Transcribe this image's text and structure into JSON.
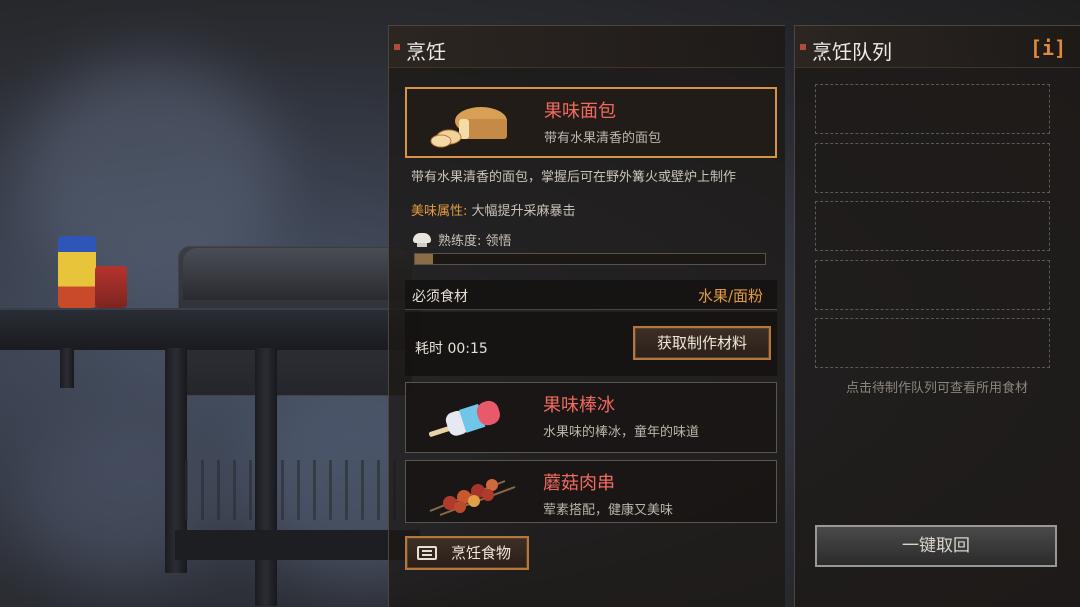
{
  "cooking_panel": {
    "title": "烹饪"
  },
  "queue_panel": {
    "title": "烹饪队列",
    "info_label": "[i]",
    "hint": "点击待制作队列可查看所用食材",
    "recall_all": "一键取回"
  },
  "recipes": [
    {
      "name": "果味面包",
      "desc": "带有水果清香的面包",
      "icon": "bread-icon",
      "selected": true
    },
    {
      "name": "果味棒冰",
      "desc": "水果味的棒冰，童年的味道",
      "icon": "popsicle-icon",
      "selected": false
    },
    {
      "name": "蘑菇肉串",
      "desc": "荤素搭配，健康又美味",
      "icon": "skewer-icon",
      "selected": false
    }
  ],
  "detail": {
    "description": "带有水果清香的面包，掌握后可在野外篝火或壁炉上制作",
    "flavor_label": "美味属性:",
    "flavor_value": "大幅提升采麻暴击",
    "proficiency": "熟练度: 领悟",
    "proficiency_level": 0.05,
    "required_label": "必须食材",
    "required_value": "水果/面粉",
    "time": "耗时 00:15",
    "get_materials": "获取制作材料"
  },
  "cook_food_button": "烹饪食物",
  "colors": {
    "accent": "#d59446",
    "recipe_name": "#f06a5e",
    "highlight": "#e39b3f"
  }
}
